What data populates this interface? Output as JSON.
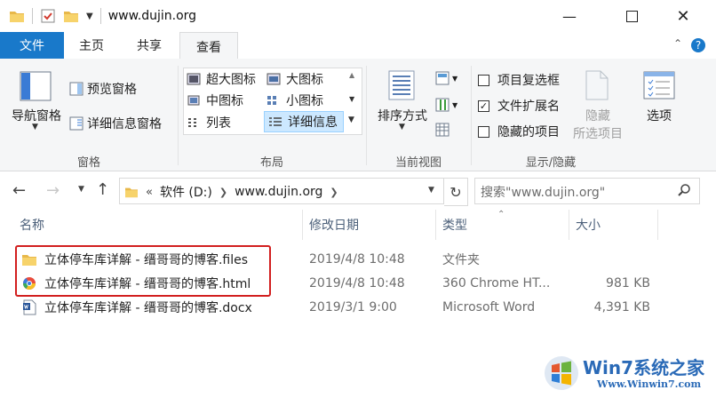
{
  "window": {
    "title": "www.dujin.org"
  },
  "tabs": [
    {
      "label": "文件"
    },
    {
      "label": "主页"
    },
    {
      "label": "共享"
    },
    {
      "label": "查看"
    }
  ],
  "ribbon": {
    "panes": {
      "nav_pane": "导航窗格",
      "preview_pane": "预览窗格",
      "details_pane": "详细信息窗格",
      "group": "窗格"
    },
    "layout": {
      "extra_large": "超大图标",
      "large": "大图标",
      "medium": "中图标",
      "small": "小图标",
      "list": "列表",
      "details": "详细信息",
      "group": "布局"
    },
    "current_view": {
      "sort_by": "排序方式",
      "group": "当前视图"
    },
    "show_hide": {
      "item_checkboxes": "项目复选框",
      "item_checkboxes_checked": false,
      "file_extensions": "文件扩展名",
      "file_extensions_checked": true,
      "hidden_items": "隐藏的项目",
      "hidden_items_checked": false,
      "hide_selected_1": "隐藏",
      "hide_selected_2": "所选项目",
      "options": "选项",
      "group": "显示/隐藏"
    }
  },
  "address": {
    "prefix": "«",
    "crumbs": [
      "软件 (D:)",
      "www.dujin.org"
    ],
    "search_placeholder": "搜索\"www.dujin.org\""
  },
  "columns": {
    "name": "名称",
    "date": "修改日期",
    "type": "类型",
    "size": "大小"
  },
  "files": [
    {
      "name": "立体停车库详解 - 缙哥哥的博客.files",
      "date": "2019/4/8 10:48",
      "type": "文件夹",
      "size": "",
      "icon": "folder-icon"
    },
    {
      "name": "立体停车库详解 - 缙哥哥的博客.html",
      "date": "2019/4/8 10:48",
      "type": "360 Chrome HT...",
      "size": "981 KB",
      "icon": "chrome-html-icon"
    },
    {
      "name": "立体停车库详解 - 缙哥哥的博客.docx",
      "date": "2019/3/1 9:00",
      "type": "Microsoft Word",
      "size": "4,391 KB",
      "icon": "word-doc-icon"
    }
  ],
  "watermark": {
    "brand": "Win7系统之家",
    "url": "Www.Winwin7.com"
  },
  "colors": {
    "file_tab": "#1979ca",
    "highlight_box": "#d21f1f",
    "selected_layout": "#cce8ff"
  }
}
